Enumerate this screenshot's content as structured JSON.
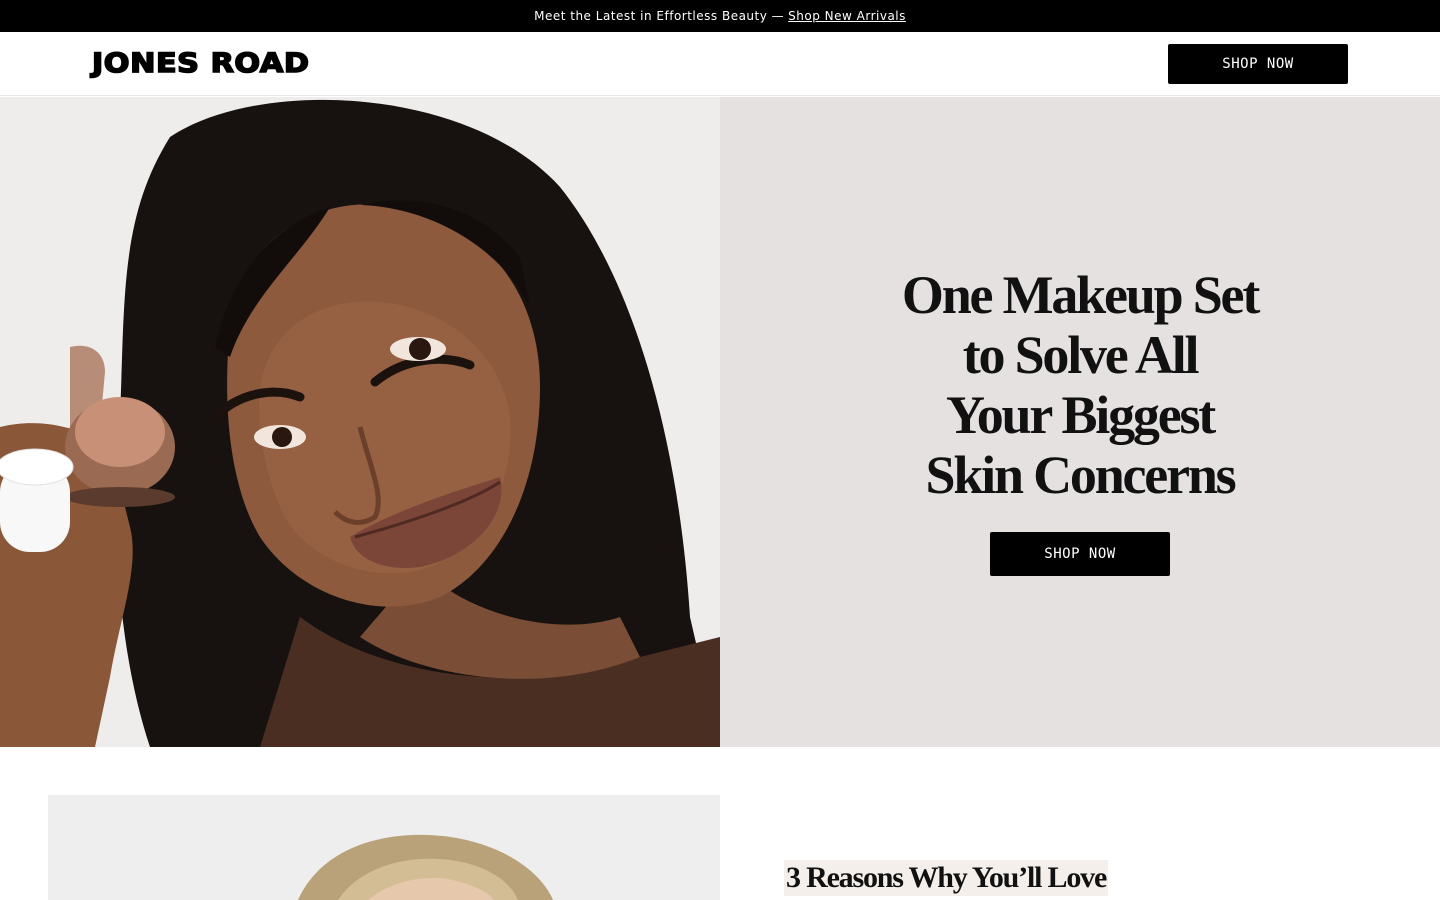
{
  "announcement": {
    "text": "Meet the Latest in Effortless Beauty —",
    "link": "Shop New Arrivals"
  },
  "header": {
    "logo": "JONES ROAD",
    "cta": "SHOP NOW"
  },
  "hero": {
    "title_lines": [
      "One Makeup Set",
      "to Solve All",
      "Your Biggest",
      "Skin Concerns"
    ],
    "cta": "SHOP NOW"
  },
  "section2": {
    "title": "3 Reasons Why You’ll Love"
  },
  "colors": {
    "black": "#000000",
    "hero_panel": "#e5e1e0",
    "title_highlight": "#f4efea"
  }
}
